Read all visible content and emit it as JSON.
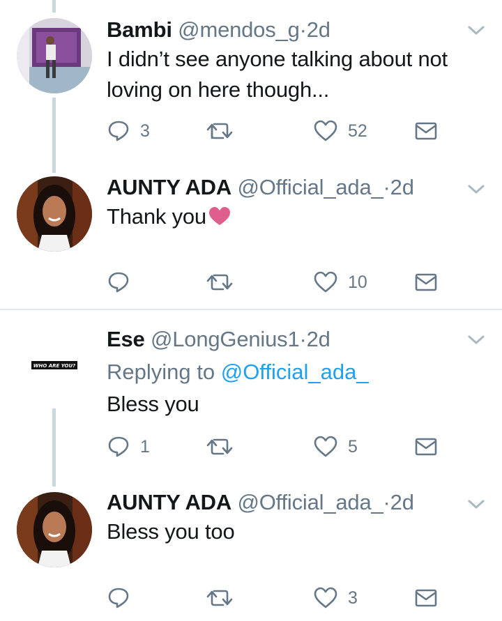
{
  "tweets": [
    {
      "name": "Bambi",
      "handle": "@mendos_g",
      "dot": "·",
      "time": "2d",
      "text_line1": "I didn’t see anyone talking about not",
      "text_line2": "loving on here though...",
      "replies": "3",
      "retweets": "",
      "likes": "52"
    },
    {
      "name": "AUNTY ADA",
      "handle": "@Official_ada_",
      "dot": "·",
      "time": "2d",
      "text": "Thank you",
      "emoji": "heart-emoji",
      "replies": "",
      "retweets": "",
      "likes": "10"
    },
    {
      "name": "Ese",
      "handle": "@LongGenius1",
      "dot": "·",
      "time": "2d",
      "avatar_text": "WHO ARE YOU?",
      "replying_prefix": "Replying to",
      "replying_to": "@Official_ada_",
      "text": "Bless you",
      "replies": "1",
      "retweets": "",
      "likes": "5"
    },
    {
      "name": "AUNTY ADA",
      "handle": "@Official_ada_",
      "dot": "·",
      "time": "2d",
      "text": "Bless you too",
      "replies": "",
      "retweets": "",
      "likes": "3"
    }
  ],
  "colors": {
    "text": "#14171a",
    "secondary": "#657786",
    "link": "#1da1f2",
    "thread_line": "#ccd6dd",
    "heart_emoji": "#e05e8d"
  }
}
